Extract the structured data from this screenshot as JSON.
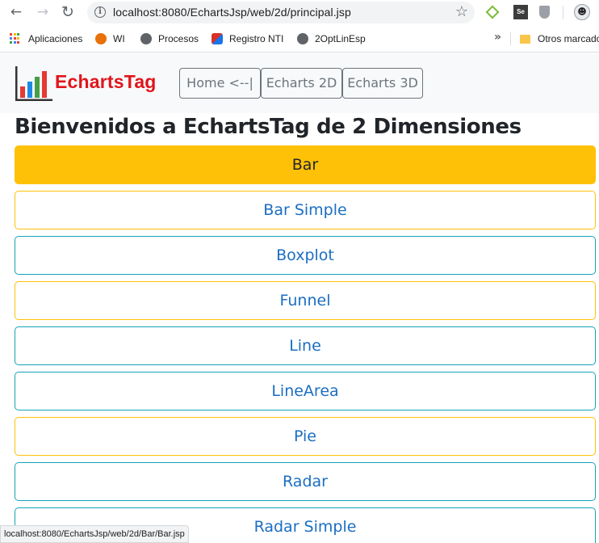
{
  "browser": {
    "url": "localhost:8080/EchartsJsp/web/2d/principal.jsp",
    "bookmarks": [
      {
        "label": "Aplicaciones",
        "icon": "apps-grid-icon"
      },
      {
        "label": "WI",
        "icon": "gear-bookmark-icon"
      },
      {
        "label": "Procesos",
        "icon": "globe-icon"
      },
      {
        "label": "Registro NTI",
        "icon": "nti-icon"
      },
      {
        "label": "2OptLinEsp",
        "icon": "globe-icon"
      }
    ],
    "other_bookmarks": "Otros marcado",
    "status_url": "localhost:8080/EchartsJsp/web/2d/Bar/Bar.jsp"
  },
  "navbar": {
    "brand": "EchartsTag",
    "links": [
      {
        "label": "Home <--|"
      },
      {
        "label": "Echarts 2D"
      },
      {
        "label": "Echarts 3D"
      }
    ]
  },
  "page_title": "Bienvenidos a EchartsTag de 2 Dimensiones",
  "chart_list": {
    "items": [
      {
        "label": "Bar",
        "state": "active"
      },
      {
        "label": "Bar Simple",
        "state": "warning"
      },
      {
        "label": "Boxplot",
        "state": "info"
      },
      {
        "label": "Funnel",
        "state": "warning"
      },
      {
        "label": "Line",
        "state": "info"
      },
      {
        "label": "LineArea",
        "state": "info"
      },
      {
        "label": "Pie",
        "state": "warning"
      },
      {
        "label": "Radar",
        "state": "info"
      },
      {
        "label": "Radar Simple",
        "state": "info"
      }
    ]
  },
  "colors": {
    "active": "#ffc107",
    "info_border": "#17a2b8",
    "link_text": "#1b6ec2",
    "brand": "#e0151b"
  }
}
